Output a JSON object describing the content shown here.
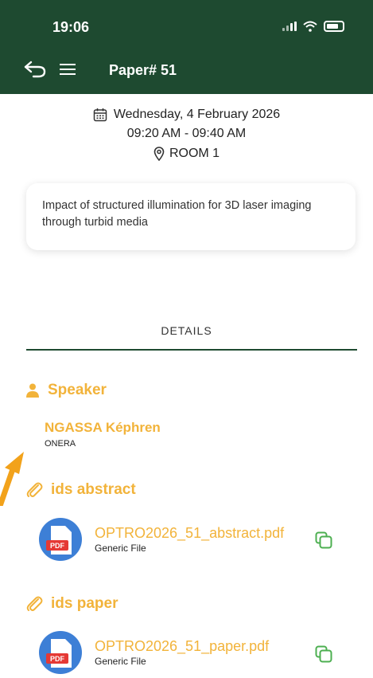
{
  "status_bar": {
    "time": "19:06"
  },
  "header": {
    "title": "Paper# 51"
  },
  "schedule": {
    "date": "Wednesday, 4 February 2026",
    "time": "09:20 AM - 09:40 AM",
    "room": "ROOM 1"
  },
  "card": {
    "title": "Impact of structured illumination for 3D laser imaging through turbid media"
  },
  "tabs": {
    "details": "DETAILS"
  },
  "speaker_section": {
    "heading": "Speaker",
    "name": "NGASSA Képhren",
    "affiliation": "ONERA"
  },
  "abstract_section": {
    "heading": "ids abstract",
    "file_name": "OPTRO2026_51_abstract.pdf",
    "file_type": "Generic File",
    "pdf_label": "PDF"
  },
  "paper_section": {
    "heading": "ids paper",
    "file_name": "OPTRO2026_51_paper.pdf",
    "file_type": "Generic File",
    "pdf_label": "PDF"
  },
  "colors": {
    "header_bg": "#1e4a30",
    "accent": "#f2b33a",
    "copy_icon": "#4caf50",
    "pdf_circle": "#3d7fd6",
    "pdf_badge": "#e53935"
  },
  "icons": [
    "back-icon",
    "menu-icon",
    "calendar-icon",
    "location-pin-icon",
    "person-icon",
    "paperclip-icon",
    "pdf-file-icon",
    "copy-icon",
    "arrow-icon"
  ]
}
